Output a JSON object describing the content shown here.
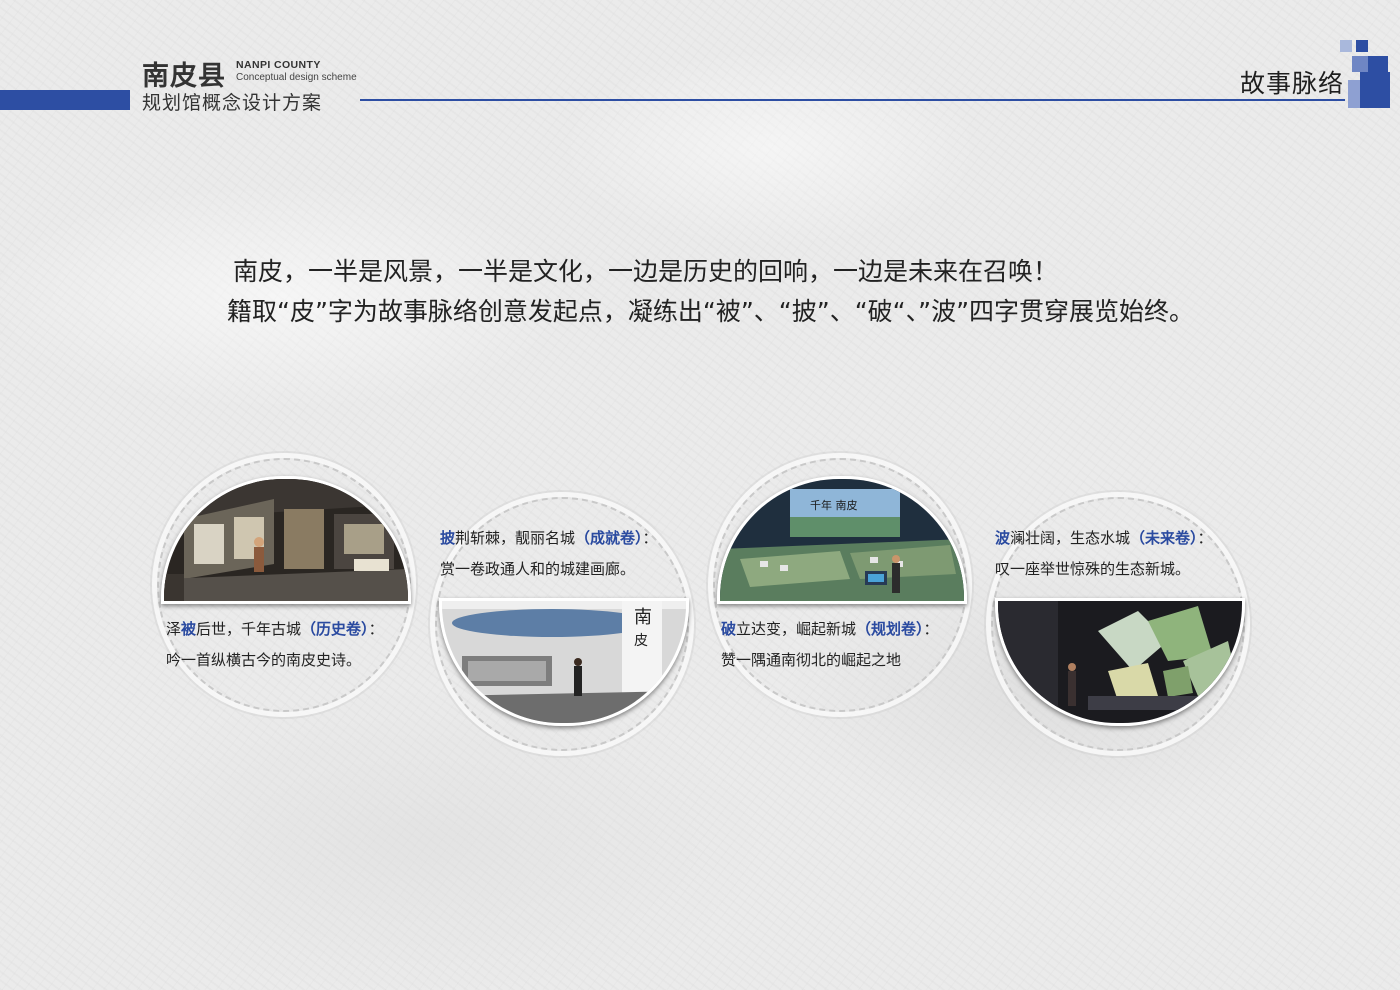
{
  "header": {
    "logo_cn": "南皮县",
    "logo_en": "NANPI COUNTY",
    "logo_en_sub": "Conceptual design scheme",
    "logo_sub": "规划馆概念设计方案",
    "section_title": "故事脉络",
    "accent_color": "#2d4ea3"
  },
  "intro": {
    "para1": "南皮，一半是风景，一半是文化，一边是历史的回响，一边是未来在召唤！",
    "para2": "籍取“皮”字为故事脉络创意发起点，凝练出“被”、“披”、“破“、”波”四字贯穿展览始终。"
  },
  "stories": [
    {
      "key_char": "被",
      "line1_pre": "泽",
      "line1_post": "后世，千年古城",
      "volume": "（历史卷）",
      "colon": "：",
      "line2": "吟一首纵横古今的南皮史诗。"
    },
    {
      "key_char": "披",
      "line1_pre": "",
      "line1_post": "荆斩棘，靓丽名城",
      "volume": "（成就卷）",
      "colon": "：",
      "line2": "赏一卷政通人和的城建画廊。"
    },
    {
      "key_char": "破",
      "line1_pre": "",
      "line1_post": "立达变，崛起新城",
      "volume": "（规划卷）",
      "colon": "：",
      "line2": "赞一隅通南彻北的崛起之地"
    },
    {
      "key_char": "波",
      "line1_pre": "",
      "line1_post": "澜壮阔，生态水城",
      "volume": "（未来卷）",
      "colon": "：",
      "line2": "叹一座举世惊殊的生态新城。"
    }
  ]
}
